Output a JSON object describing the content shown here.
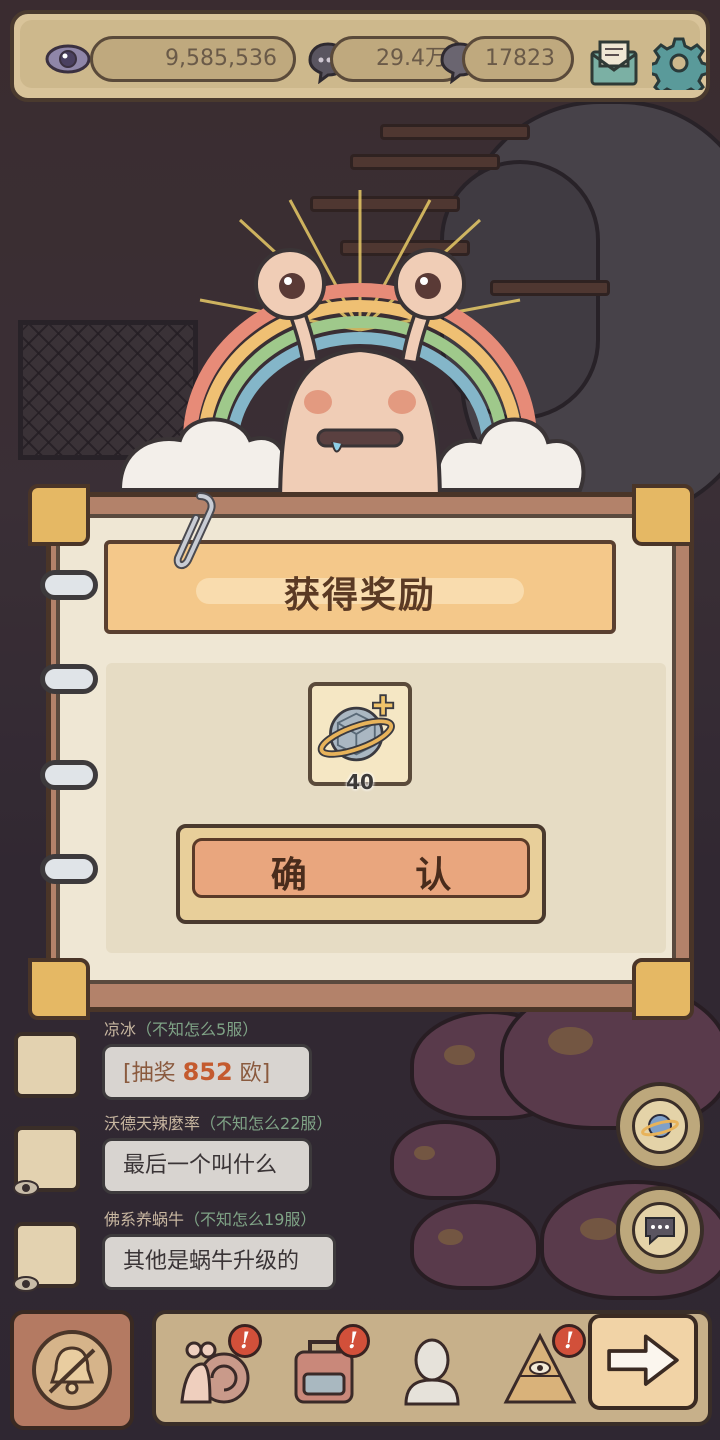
{
  "topbar": {
    "views": "9,585,536",
    "stat2": "29.4万",
    "stat3": "17823"
  },
  "dialog": {
    "title": "获得奖励",
    "reward": {
      "icon": "planet-ring-item-icon",
      "count": "40"
    },
    "confirm_label": "确 认"
  },
  "chat": [
    {
      "name": "凉冰",
      "server": "（不知怎么5服）",
      "message_prefix": "[抽奖 ",
      "message_value": "852",
      "message_suffix": " 欧]"
    },
    {
      "name": "沃德天辣麼率",
      "server": "（不知怎么22服）",
      "message": "最后一个叫什么"
    },
    {
      "name": "佛系养蜗牛",
      "server": "（不知怎么19服）",
      "message": "其他是蜗牛升级的"
    }
  ],
  "bottom_nav": {
    "badge": "!",
    "items": [
      "snail-icon",
      "backpack-icon",
      "bust-statue-icon",
      "pyramid-eye-icon"
    ],
    "next": "arrow-right-icon"
  },
  "colors": {
    "paper": "#efe7d4",
    "title_plate": "#f4c88a",
    "confirm": "#e9a67e",
    "badge": "#d2503a"
  }
}
